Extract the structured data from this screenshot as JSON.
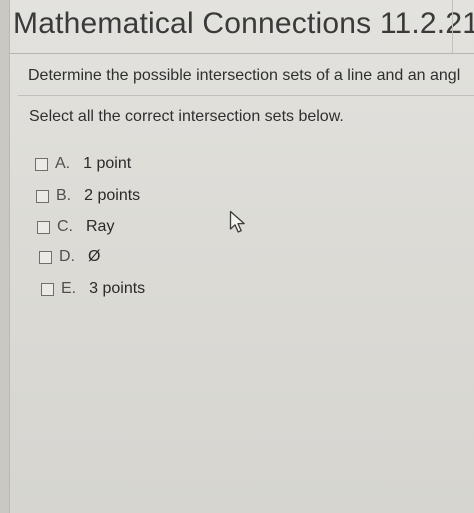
{
  "header": {
    "title": "Mathematical Connections 11.2.21"
  },
  "question": {
    "text": "Determine the possible intersection sets of a line and an angl"
  },
  "instruction": {
    "text": "Select all the correct intersection sets below."
  },
  "options": [
    {
      "letter": "A.",
      "text": "1 point",
      "checked": false
    },
    {
      "letter": "B.",
      "text": "2 points",
      "checked": false
    },
    {
      "letter": "C.",
      "text": "Ray",
      "checked": false
    },
    {
      "letter": "D.",
      "text": "Ø",
      "checked": false
    },
    {
      "letter": "E.",
      "text": "3 points",
      "checked": false
    }
  ],
  "icons": {
    "cursor": "mouse-pointer-icon"
  },
  "colors": {
    "background": "#dcdbd6",
    "text": "#2d2d2d",
    "checkbox_border": "#6f6f6c"
  }
}
